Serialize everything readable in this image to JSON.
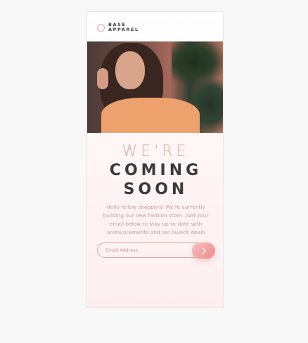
{
  "brand": {
    "line1": "BASE",
    "line2": "APPAREL",
    "logo_icon": "circle-outline-icon",
    "accent": "#e6a9a9"
  },
  "hero": {
    "image_alt": "woman-portrait-photo"
  },
  "headline": {
    "line1": "WE'RE",
    "line2": "COMING",
    "line3": "SOON"
  },
  "body": {
    "text": "Hello fellow shoppers! We're currently building our new fashion store. Add your email below to stay up-to-date with announcements and our launch deals"
  },
  "form": {
    "email_placeholder": "Email Address",
    "email_value": "",
    "submit_icon": "chevron-right-icon"
  },
  "colors": {
    "accent_pink": "#e3a5a5",
    "dark_text": "#3b3939",
    "button_gradient_start": "#f8bfbf",
    "button_gradient_end": "#ef8a8a"
  }
}
